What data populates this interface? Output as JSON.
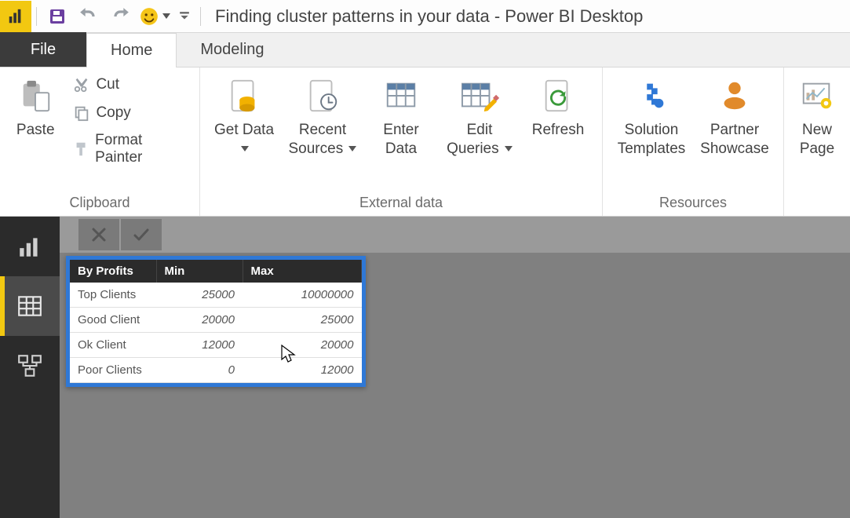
{
  "titlebar": {
    "title": "Finding cluster patterns in your data - Power BI Desktop"
  },
  "tabs": {
    "file": "File",
    "home": "Home",
    "modeling": "Modeling"
  },
  "ribbon": {
    "clipboard": {
      "title": "Clipboard",
      "paste": "Paste",
      "cut": "Cut",
      "copy": "Copy",
      "format_painter": "Format Painter"
    },
    "external": {
      "title": "External data",
      "get_data": "Get Data",
      "recent_sources": "Recent Sources",
      "enter_data": "Enter Data",
      "edit_queries": "Edit Queries",
      "refresh": "Refresh"
    },
    "resources": {
      "title": "Resources",
      "solution_templates": "Solution Templates",
      "partner_showcase": "Partner Showcase"
    },
    "insert": {
      "new_page": "New Page"
    }
  },
  "table": {
    "headers": {
      "c0": "By Profits",
      "c1": "Min",
      "c2": "Max"
    },
    "rows": [
      {
        "label": "Top Clients",
        "min": "25000",
        "max": "10000000"
      },
      {
        "label": "Good Client",
        "min": "20000",
        "max": "25000"
      },
      {
        "label": "Ok Client",
        "min": "12000",
        "max": "20000"
      },
      {
        "label": "Poor Clients",
        "min": "0",
        "max": "12000"
      }
    ]
  }
}
